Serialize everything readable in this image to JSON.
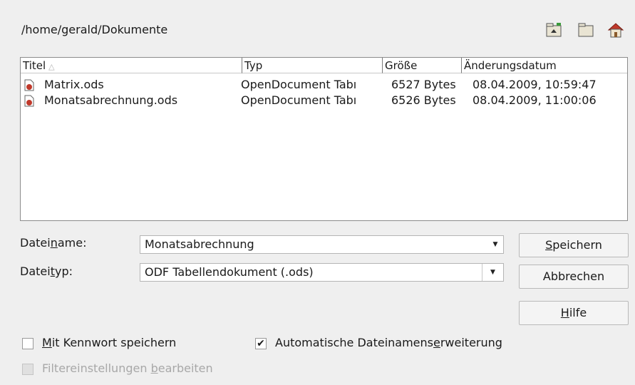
{
  "path": "/home/gerald/Dokumente",
  "toolbar": {
    "up_icon": "folder-up-icon",
    "new_folder_icon": "new-folder-icon",
    "home_icon": "home-icon"
  },
  "columns": [
    "Titel",
    "Typ",
    "Größe",
    "Änderungsdatum"
  ],
  "files": [
    {
      "name": "Matrix.ods",
      "type": "OpenDocument Tabı",
      "size": "6527 Bytes",
      "date": "08.04.2009, 10:59:47"
    },
    {
      "name": "Monatsabrechnung.ods",
      "type": "OpenDocument Tabı",
      "size": "6526 Bytes",
      "date": "08.04.2009, 11:00:06"
    }
  ],
  "filename": {
    "label_pre": "Datei",
    "label_u": "n",
    "label_post": "ame:",
    "value": "Monatsabrechnung"
  },
  "filetype": {
    "label_pre": "Datei",
    "label_u": "t",
    "label_post": "yp:",
    "value": "ODF Tabellendokument (.ods)"
  },
  "buttons": {
    "save": {
      "u": "S",
      "rest": "peichern"
    },
    "cancel": "Abbrechen",
    "help": {
      "u": "H",
      "rest": "ilfe"
    }
  },
  "options": {
    "password": {
      "u": "M",
      "rest": "it Kennwort speichern",
      "checked": false
    },
    "auto_ext": {
      "pre": "Automatische Dateinamens",
      "u": "e",
      "post": "rweiterung",
      "checked": true
    },
    "filter": {
      "pre": "Filtereinstellungen ",
      "u": "b",
      "post": "earbeiten",
      "checked": false,
      "disabled": true
    }
  },
  "colors": {
    "accent_icon": "#c0392b",
    "folder_icon": "#d8c98a"
  }
}
